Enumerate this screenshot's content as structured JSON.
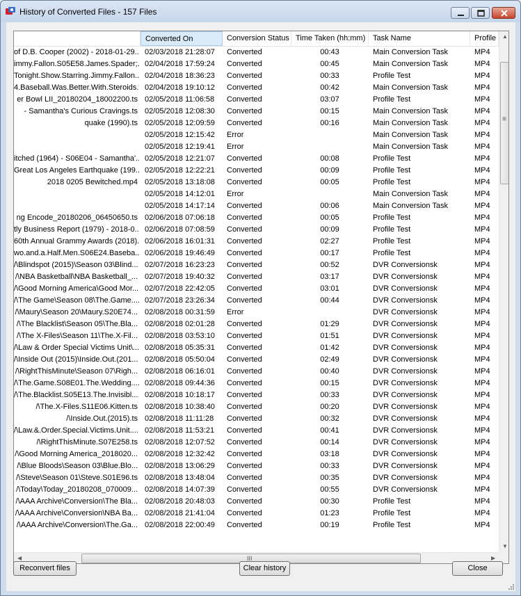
{
  "window": {
    "title": "History of Converted Files - 157 Files"
  },
  "columns": [
    {
      "label": ""
    },
    {
      "label": "Converted On"
    },
    {
      "label": "Conversion Status"
    },
    {
      "label": "Time Taken (hh:mm)"
    },
    {
      "label": "Task Name"
    },
    {
      "label": "Profile"
    }
  ],
  "rows": [
    {
      "file": "of D.B. Cooper (2002) - 2018-01-29...",
      "converted_on": "02/03/2018 21:28:07",
      "status": "Converted",
      "time": "00:43",
      "task": "Main Conversion Task",
      "profile": "MP4"
    },
    {
      "file": "immy.Fallon.S05E58.James.Spader;...",
      "converted_on": "02/04/2018 17:59:24",
      "status": "Converted",
      "time": "00:45",
      "task": "Main Conversion Task",
      "profile": "MP4"
    },
    {
      "file": "Tonight.Show.Starring.Jimmy.Fallon....",
      "converted_on": "02/04/2018 18:36:23",
      "status": "Converted",
      "time": "00:33",
      "task": "Profile Test",
      "profile": "MP4"
    },
    {
      "file": "4.Baseball.Was.Better.With.Steroids.ts",
      "converted_on": "02/04/2018 19:10:12",
      "status": "Converted",
      "time": "00:42",
      "task": "Main Conversion Task",
      "profile": "MP4"
    },
    {
      "file": "er Bowl LII_20180204_18002200.ts",
      "converted_on": "02/05/2018 11:06:58",
      "status": "Converted",
      "time": "03:07",
      "task": "Profile Test",
      "profile": "MP4"
    },
    {
      "file": "- Samantha's Curious Cravings.ts",
      "converted_on": "02/05/2018 12:08:30",
      "status": "Converted",
      "time": "00:15",
      "task": "Main Conversion Task",
      "profile": "MP4"
    },
    {
      "file": "quake (1990).ts",
      "converted_on": "02/05/2018 12:09:59",
      "status": "Converted",
      "time": "00:16",
      "task": "Main Conversion Task",
      "profile": "MP4"
    },
    {
      "file": "",
      "converted_on": "02/05/2018 12:15:42",
      "status": "Error",
      "time": "",
      "task": "Main Conversion Task",
      "profile": "MP4"
    },
    {
      "file": "",
      "converted_on": "02/05/2018 12:19:41",
      "status": "Error",
      "time": "",
      "task": "Main Conversion Task",
      "profile": "MP4"
    },
    {
      "file": "itched (1964) - S06E04 - Samantha'...",
      "converted_on": "02/05/2018 12:21:07",
      "status": "Converted",
      "time": "00:08",
      "task": "Profile Test",
      "profile": "MP4"
    },
    {
      "file": "Great Los Angeles Earthquake (199...",
      "converted_on": "02/05/2018 12:22:21",
      "status": "Converted",
      "time": "00:09",
      "task": "Profile Test",
      "profile": "MP4"
    },
    {
      "file": "2018 0205 Bewitched.mp4",
      "converted_on": "02/05/2018 13:18:08",
      "status": "Converted",
      "time": "00:05",
      "task": "Profile Test",
      "profile": "MP4"
    },
    {
      "file": "",
      "converted_on": "02/05/2018 14:12:01",
      "status": "Error",
      "time": "",
      "task": "Main Conversion Task",
      "profile": "MP4"
    },
    {
      "file": "",
      "converted_on": "02/05/2018 14:17:14",
      "status": "Converted",
      "time": "00:06",
      "task": "Main Conversion Task",
      "profile": "MP4"
    },
    {
      "file": "ng Encode_20180206_06450650.ts",
      "converted_on": "02/06/2018 07:06:18",
      "status": "Converted",
      "time": "00:05",
      "task": "Profile Test",
      "profile": "MP4"
    },
    {
      "file": "tly Business Report (1979) - 2018-0...",
      "converted_on": "02/06/2018 07:08:59",
      "status": "Converted",
      "time": "00:09",
      "task": "Profile Test",
      "profile": "MP4"
    },
    {
      "file": "60th Annual Grammy Awards (2018)...",
      "converted_on": "02/06/2018 16:01:31",
      "status": "Converted",
      "time": "02:27",
      "task": "Profile Test",
      "profile": "MP4"
    },
    {
      "file": "wo.and.a.Half.Men.S06E24.Baseba...",
      "converted_on": "02/06/2018 19:46:49",
      "status": "Converted",
      "time": "00:17",
      "task": "Profile Test",
      "profile": "MP4"
    },
    {
      "file": "/\\Blindspot (2015)\\Season 03\\Blind...",
      "converted_on": "02/07/2018 16:23:23",
      "status": "Converted",
      "time": "00:52",
      "task": "DVR Conversionsk",
      "profile": "MP4"
    },
    {
      "file": "/\\NBA Basketball\\NBA Basketball_...",
      "converted_on": "02/07/2018 19:40:32",
      "status": "Converted",
      "time": "03:17",
      "task": "DVR Conversionsk",
      "profile": "MP4"
    },
    {
      "file": "/\\Good Morning America\\Good Mor...",
      "converted_on": "02/07/2018 22:42:05",
      "status": "Converted",
      "time": "03:01",
      "task": "DVR Conversionsk",
      "profile": "MP4"
    },
    {
      "file": "/\\The Game\\Season 08\\The.Game....",
      "converted_on": "02/07/2018 23:26:34",
      "status": "Converted",
      "time": "00:44",
      "task": "DVR Conversionsk",
      "profile": "MP4"
    },
    {
      "file": "/\\Maury\\Season 20\\Maury.S20E74...",
      "converted_on": "02/08/2018 00:31:59",
      "status": "Error",
      "time": "",
      "task": "DVR Conversionsk",
      "profile": "MP4"
    },
    {
      "file": "/\\The Blacklist\\Season 05\\The.Bla...",
      "converted_on": "02/08/2018 02:01:28",
      "status": "Converted",
      "time": "01:29",
      "task": "DVR Conversionsk",
      "profile": "MP4"
    },
    {
      "file": "/\\The X-Files\\Season 11\\The.X-Fil...",
      "converted_on": "02/08/2018 03:53:10",
      "status": "Converted",
      "time": "01:51",
      "task": "DVR Conversionsk",
      "profile": "MP4"
    },
    {
      "file": "/\\Law & Order Special Victims Unit\\...",
      "converted_on": "02/08/2018 05:35:31",
      "status": "Converted",
      "time": "01:42",
      "task": "DVR Conversionsk",
      "profile": "MP4"
    },
    {
      "file": "/\\Inside Out (2015)\\Inside.Out.(201...",
      "converted_on": "02/08/2018 05:50:04",
      "status": "Converted",
      "time": "02:49",
      "task": "DVR Conversionsk",
      "profile": "MP4"
    },
    {
      "file": "/\\RightThisMinute\\Season 07\\Righ...",
      "converted_on": "02/08/2018 06:16:01",
      "status": "Converted",
      "time": "00:40",
      "task": "DVR Conversionsk",
      "profile": "MP4"
    },
    {
      "file": "/\\The.Game.S08E01.The.Wedding....",
      "converted_on": "02/08/2018 09:44:36",
      "status": "Converted",
      "time": "00:15",
      "task": "DVR Conversionsk",
      "profile": "MP4"
    },
    {
      "file": "/\\The.Blacklist.S05E13.The.Invisibl...",
      "converted_on": "02/08/2018 10:18:17",
      "status": "Converted",
      "time": "00:33",
      "task": "DVR Conversionsk",
      "profile": "MP4"
    },
    {
      "file": "/\\The.X-Files.S11E06.Kitten.ts",
      "converted_on": "02/08/2018 10:38:40",
      "status": "Converted",
      "time": "00:20",
      "task": "DVR Conversionsk",
      "profile": "MP4"
    },
    {
      "file": "/\\Inside.Out.(2015).ts",
      "converted_on": "02/08/2018 11:11:28",
      "status": "Converted",
      "time": "00:32",
      "task": "DVR Conversionsk",
      "profile": "MP4"
    },
    {
      "file": "/\\Law.&.Order.Special.Victims.Unit....",
      "converted_on": "02/08/2018 11:53:21",
      "status": "Converted",
      "time": "00:41",
      "task": "DVR Conversionsk",
      "profile": "MP4"
    },
    {
      "file": "/\\RightThisMinute.S07E258.ts",
      "converted_on": "02/08/2018 12:07:52",
      "status": "Converted",
      "time": "00:14",
      "task": "DVR Conversionsk",
      "profile": "MP4"
    },
    {
      "file": "/\\Good Morning America_2018020...",
      "converted_on": "02/08/2018 12:32:42",
      "status": "Converted",
      "time": "03:18",
      "task": "DVR Conversionsk",
      "profile": "MP4"
    },
    {
      "file": "/\\Blue Bloods\\Season 03\\Blue.Blo...",
      "converted_on": "02/08/2018 13:06:29",
      "status": "Converted",
      "time": "00:33",
      "task": "DVR Conversionsk",
      "profile": "MP4"
    },
    {
      "file": "/\\Steve\\Season 01\\Steve.S01E96.ts",
      "converted_on": "02/08/2018 13:48:04",
      "status": "Converted",
      "time": "00:35",
      "task": "DVR Conversionsk",
      "profile": "MP4"
    },
    {
      "file": "/\\Today\\Today_20180208_070009...",
      "converted_on": "02/08/2018 14:07:39",
      "status": "Converted",
      "time": "00:55",
      "task": "DVR Conversionsk",
      "profile": "MP4"
    },
    {
      "file": "/\\AAA Archive\\Conversion\\The Bla...",
      "converted_on": "02/08/2018 20:48:03",
      "status": "Converted",
      "time": "00:30",
      "task": "Profile Test",
      "profile": "MP4"
    },
    {
      "file": "/\\AAA Archive\\Conversion\\NBA Ba...",
      "converted_on": "02/08/2018 21:41:04",
      "status": "Converted",
      "time": "01:23",
      "task": "Profile Test",
      "profile": "MP4"
    },
    {
      "file": "/\\AAA Archive\\Conversion\\The.Ga...",
      "converted_on": "02/08/2018 22:00:49",
      "status": "Converted",
      "time": "00:19",
      "task": "Profile Test",
      "profile": "MP4"
    }
  ],
  "buttons": {
    "reconvert": "Reconvert files",
    "clear": "Clear history",
    "close": "Close"
  },
  "scroll": {
    "hscroll_grip": "III",
    "vscroll_grip": "≡"
  }
}
